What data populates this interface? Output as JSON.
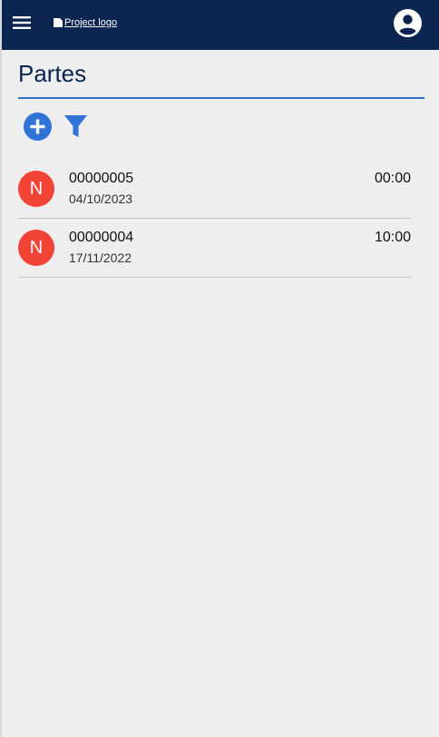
{
  "header": {
    "logo_alt": "Project logo",
    "menu_icon": "hamburger-menu-icon",
    "account_icon": "account-circle-icon",
    "background": "#0b2450"
  },
  "page": {
    "title": "Partes",
    "accent": "#2f74c0"
  },
  "toolbar": {
    "add_icon": "add-circle-icon",
    "filter_icon": "filter-icon"
  },
  "partes": [
    {
      "initial": "N",
      "number": "00000005",
      "date": "04/10/2023",
      "time": "00:00"
    },
    {
      "initial": "N",
      "number": "00000004",
      "date": "17/11/2022",
      "time": "10:00"
    }
  ]
}
